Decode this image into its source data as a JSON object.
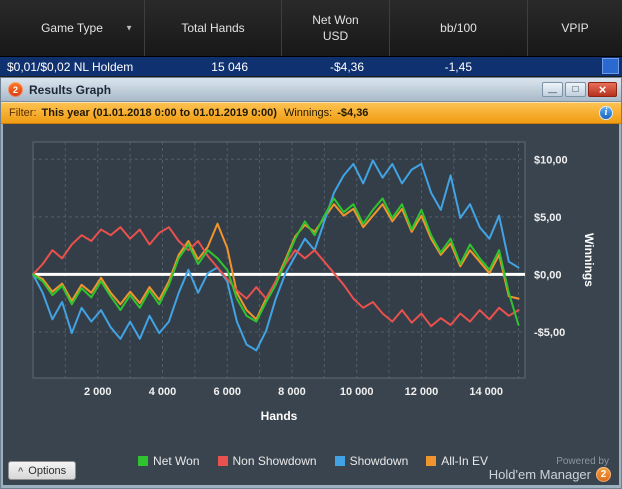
{
  "icons": {
    "dropdown": "▼",
    "minimize": "—",
    "maximize": "□",
    "close": "×",
    "info": "i",
    "options_caret": "^"
  },
  "grid": {
    "columns": [
      {
        "label": "Game Type"
      },
      {
        "label": "Total Hands"
      },
      {
        "label": "Net Won",
        "label2": "USD"
      },
      {
        "label": "bb/100"
      },
      {
        "label": "VPIP"
      }
    ],
    "row": {
      "game_type": "$0,01/$0,02 NL Holdem",
      "total_hands": "15 046",
      "net_won_usd": "-$4,36",
      "bb_100": "-1,45",
      "vpip": ""
    }
  },
  "window": {
    "title": "Results Graph",
    "app_badge": "2",
    "filter": {
      "label": "Filter:",
      "range": "This year (01.01.2018 0:00 to 01.01.2019 0:00)",
      "winnings_label": "Winnings:",
      "winnings_value": "-$4,36"
    },
    "footer": {
      "options_label": "Options",
      "powered_by": "Powered by",
      "brand": "Hold'em Manager",
      "brand_badge": "2"
    }
  },
  "chart_data": {
    "type": "line",
    "title": "",
    "xlabel": "Hands",
    "ylabel": "Winnings",
    "xlim": [
      0,
      15200
    ],
    "ylim": [
      -9,
      11.5
    ],
    "x_grid_step": 1000,
    "zero_line": true,
    "grid": "dashed",
    "legend_position": "bottom",
    "x_ticks": [
      2000,
      4000,
      6000,
      8000,
      10000,
      12000,
      14000
    ],
    "x_tick_labels": [
      "2 000",
      "4 000",
      "6 000",
      "8 000",
      "10 000",
      "12 000",
      "14 000"
    ],
    "y_ticks": [
      10,
      5,
      0,
      -5
    ],
    "y_tick_labels": [
      "$10,00",
      "$5,00",
      "$0,00",
      "-$5,00"
    ],
    "x": [
      0,
      300,
      600,
      900,
      1200,
      1500,
      1800,
      2100,
      2400,
      2700,
      3000,
      3300,
      3600,
      3900,
      4200,
      4500,
      4800,
      5100,
      5400,
      5700,
      6000,
      6300,
      6600,
      6900,
      7200,
      7500,
      7800,
      8100,
      8400,
      8700,
      9000,
      9300,
      9600,
      9900,
      10200,
      10500,
      10800,
      11100,
      11400,
      11700,
      12000,
      12300,
      12600,
      12900,
      13200,
      13500,
      13800,
      14100,
      14400,
      14700,
      15000
    ],
    "series": [
      {
        "name": "Net Won",
        "color": "#30c330",
        "values": [
          0,
          -0.6,
          -1.8,
          -1.0,
          -2.6,
          -1.2,
          -2.0,
          -0.6,
          -1.9,
          -3.1,
          -1.8,
          -2.9,
          -1.4,
          -2.6,
          -0.9,
          1.4,
          2.6,
          0.9,
          2.1,
          1.4,
          0.4,
          -2.1,
          -3.6,
          -4.1,
          -2.4,
          -0.9,
          1.1,
          3.1,
          4.6,
          3.4,
          5.1,
          6.6,
          5.4,
          6.1,
          4.4,
          5.6,
          6.6,
          4.9,
          6.1,
          3.9,
          5.6,
          3.4,
          1.9,
          3.1,
          0.9,
          2.6,
          1.4,
          0.4,
          2.1,
          -1.6,
          -4.4
        ]
      },
      {
        "name": "Non Showdown",
        "color": "#e8514d",
        "values": [
          0,
          0.9,
          2.1,
          1.4,
          2.6,
          3.4,
          2.9,
          3.9,
          3.4,
          4.1,
          3.1,
          3.9,
          2.6,
          3.6,
          4.1,
          2.9,
          2.1,
          2.9,
          1.6,
          0.6,
          -0.4,
          -1.4,
          -2.1,
          -1.1,
          -2.1,
          -0.6,
          0.9,
          2.1,
          1.4,
          2.1,
          1.1,
          0.1,
          -0.9,
          -2.1,
          -2.9,
          -2.4,
          -3.4,
          -4.1,
          -3.1,
          -4.2,
          -3.4,
          -4.5,
          -3.8,
          -4.4,
          -3.4,
          -4.1,
          -3.1,
          -3.9,
          -2.9,
          -3.6,
          -3.1
        ]
      },
      {
        "name": "Showdown",
        "color": "#41a3e3",
        "values": [
          0,
          -1.6,
          -3.9,
          -2.4,
          -5.1,
          -2.9,
          -4.1,
          -3.1,
          -4.6,
          -5.6,
          -4.1,
          -5.6,
          -3.6,
          -5.1,
          -4.1,
          -1.6,
          0.4,
          -1.6,
          0.1,
          0.6,
          -0.6,
          -4.1,
          -6.1,
          -6.6,
          -4.9,
          -2.1,
          0.1,
          1.6,
          3.1,
          2.1,
          4.6,
          7.1,
          8.6,
          9.6,
          7.9,
          9.9,
          8.4,
          9.6,
          7.9,
          9.1,
          9.6,
          7.1,
          5.6,
          8.6,
          4.9,
          6.1,
          4.1,
          3.1,
          5.1,
          1.1,
          0.6
        ]
      },
      {
        "name": "All-In EV",
        "color": "#f0942d",
        "values": [
          0,
          -0.4,
          -1.5,
          -0.8,
          -2.3,
          -0.9,
          -1.6,
          -0.3,
          -1.6,
          -2.6,
          -1.5,
          -2.5,
          -1.1,
          -2.2,
          -0.6,
          1.7,
          2.9,
          1.3,
          2.4,
          4.4,
          2.3,
          -1.6,
          -3.1,
          -3.9,
          -2.1,
          -0.6,
          1.3,
          3.3,
          4.3,
          3.7,
          4.9,
          6.1,
          5.1,
          5.7,
          4.1,
          5.1,
          6.1,
          4.6,
          5.7,
          3.7,
          5.1,
          3.1,
          1.7,
          2.7,
          0.7,
          2.1,
          1.1,
          0.1,
          1.7,
          -1.9,
          -2.1
        ]
      }
    ]
  }
}
